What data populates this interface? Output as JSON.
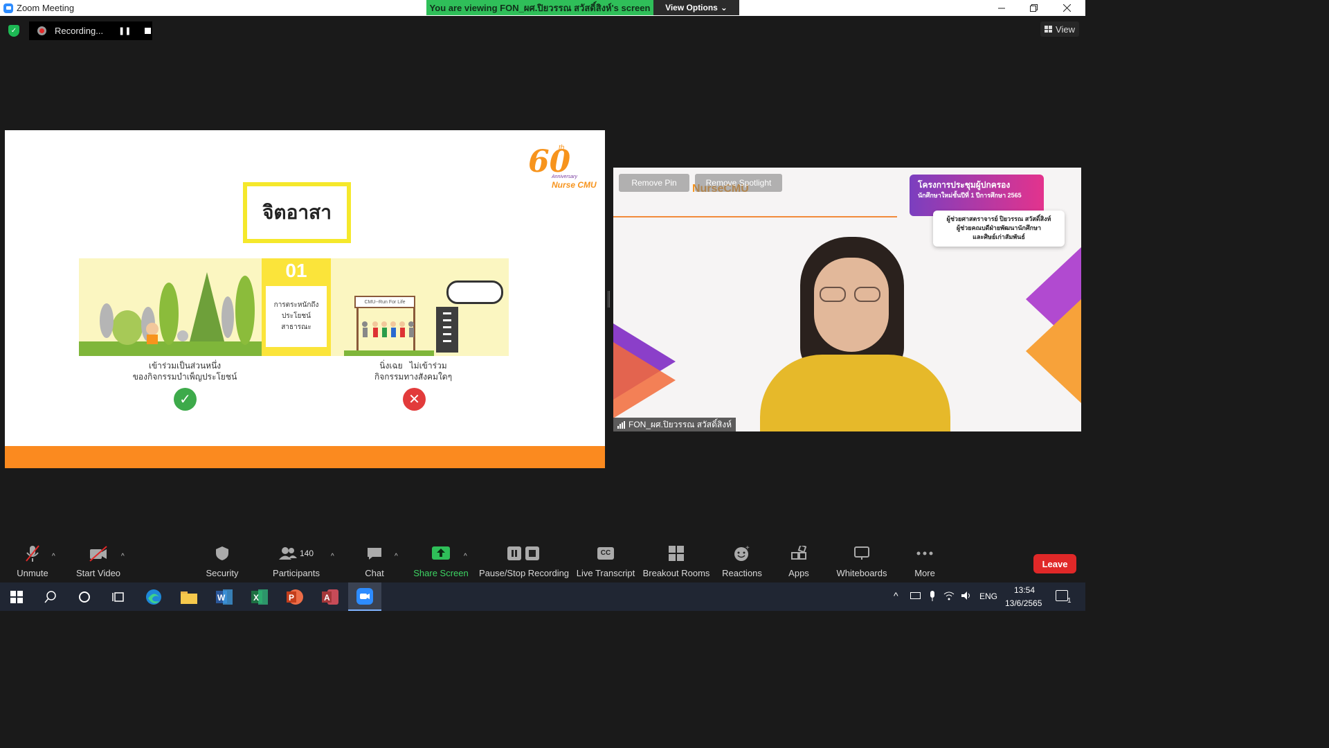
{
  "window": {
    "title": "Zoom Meeting",
    "viewing_banner": "You are viewing FON_ผศ.ปิยวรรณ สวัสดิ์สิงห์'s screen",
    "view_options_label": "View Options",
    "view_label": "View"
  },
  "recording": {
    "label": "Recording..."
  },
  "slide": {
    "heading": "จิตอาสา",
    "center_number": "01",
    "center_card_text": "การตระหนักถึงประโยชน์สาธารณะ",
    "caption_left_1": "เข้าร่วมเป็นส่วนหนึ่ง",
    "caption_left_2": "ของกิจกรรมบำเพ็ญประโยชน์",
    "caption_right_1": "นิ่งเฉย   ไม่เข้าร่วม",
    "caption_right_2": "กิจกรรมทางสังคมใดๆ",
    "sign_text": "CMU--Run For Life",
    "logo_number": "60",
    "logo_th": "th",
    "logo_anniversary": "Anniversary",
    "logo_brand": "Nurse CMU"
  },
  "video": {
    "remove_pin": "Remove Pin",
    "remove_spotlight": "Remove Spotlight",
    "nurse_logo": "NurseCMU",
    "banner_line1": "โครงการประชุมผู้ปกครอง",
    "banner_line2": "นักศึกษาใหม่ชั้นปีที่ 1 ปีการศึกษา 2565",
    "speaker_line1": "ผู้ช่วยศาสตราจารย์ ปิยวรรณ สวัสดิ์สิงห์",
    "speaker_line2": "ผู้ช่วยคณบดีฝ่ายพัฒนานักศึกษา",
    "speaker_line3": "และศิษย์เก่าสัมพันธ์",
    "participant_name": "FON_ผศ.ปิยวรรณ สวัสดิ์สิงห์"
  },
  "toolbar": {
    "unmute": "Unmute",
    "start_video": "Start Video",
    "security": "Security",
    "participants": "Participants",
    "participants_count": "140",
    "chat": "Chat",
    "share_screen": "Share Screen",
    "pause_stop_recording": "Pause/Stop Recording",
    "live_transcript": "Live Transcript",
    "breakout_rooms": "Breakout Rooms",
    "reactions": "Reactions",
    "apps": "Apps",
    "whiteboards": "Whiteboards",
    "more": "More",
    "leave": "Leave",
    "cc_badge": "CC"
  },
  "taskbar": {
    "language": "ENG",
    "time": "13:54",
    "date": "13/6/2565",
    "notification_count": "1"
  },
  "colors": {
    "share_green": "#2fbf59",
    "leave_red": "#e02828",
    "slide_orange": "#fb8a1f"
  }
}
